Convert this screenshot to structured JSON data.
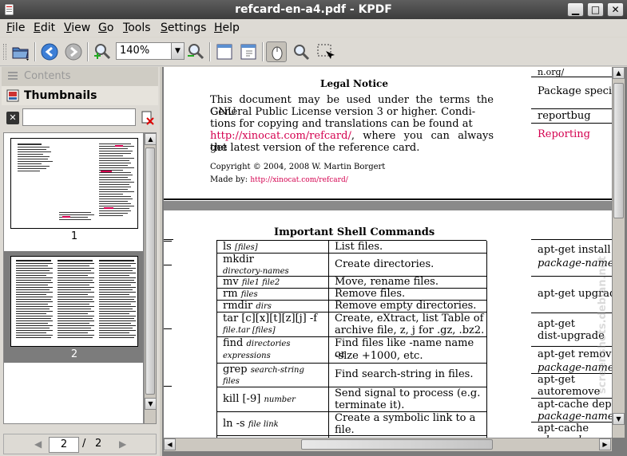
{
  "window": {
    "title": "refcard-en-a4.pdf - KPDF",
    "min_glyph": "▁",
    "max_glyph": "□",
    "close_glyph": "✕"
  },
  "menubar": {
    "items": [
      {
        "pre": "",
        "u": "F",
        "post": "ile"
      },
      {
        "pre": "",
        "u": "E",
        "post": "dit"
      },
      {
        "pre": "",
        "u": "V",
        "post": "iew"
      },
      {
        "pre": "",
        "u": "G",
        "post": "o"
      },
      {
        "pre": "",
        "u": "T",
        "post": "ools"
      },
      {
        "pre": "",
        "u": "S",
        "post": "ettings"
      },
      {
        "pre": "",
        "u": "H",
        "post": "elp"
      }
    ]
  },
  "toolbar": {
    "zoom_value": "140%",
    "zoom_arrow": "▼",
    "icons": [
      "open-folder-icon",
      "back-icon",
      "forward-icon",
      "zoom-in-icon",
      "zoom-out-icon",
      "fit-width-icon",
      "fit-page-icon",
      "browse-tool-icon",
      "zoom-tool-icon",
      "select-tool-icon"
    ]
  },
  "sidebar": {
    "contents_label": "Contents",
    "thumbnails_label": "Thumbnails",
    "search_value": "",
    "thumbs": [
      {
        "label": "1"
      },
      {
        "label": "2"
      }
    ],
    "pager": {
      "current": "2",
      "separator": "/",
      "total": "2"
    }
  },
  "document": {
    "legal_title": "Legal Notice",
    "legal_lines": [
      "This document may be used under the terms the GNU",
      "General Public License version 3 or higher.  Condi-",
      "tions for copying and translations can be found at"
    ],
    "legal_link": "http://xinocat.com/refcard/",
    "legal_after_link": ", where you can always get",
    "legal_last": "the latest version of the reference card.",
    "copyright": "Copyright © 2004, 2008 W. Martin Borgert",
    "madeby_label": "Made by:",
    "madeby_link": "http://xinocat.com/refcard/",
    "shell_title": "Important Shell Commands",
    "rows": [
      {
        "cmd": "ls",
        "arg": "[files]",
        "desc": "List files."
      },
      {
        "cmd": "mkdir",
        "arg": "directory-names",
        "desc": "Create directories."
      },
      {
        "cmd": "mv",
        "arg": "file1   file2",
        "desc": "Move, rename files."
      },
      {
        "cmd": "rm",
        "arg": "files",
        "desc": "Remove files."
      },
      {
        "cmd": "rmdir",
        "arg": "dirs",
        "desc": "Remove empty directories."
      },
      {
        "cmd": "tar [c][x][t][z][j] -f",
        "arg": "file.tar   [files]",
        "desc": "Create, eXtract, list Table of",
        "desc2": "archive file, z, j for .gz, .bz2."
      },
      {
        "cmd": "find",
        "arg": "directories",
        "arg2": "expressions",
        "desc": "Find files like -name name or",
        "desc2": "-size +1000, etc."
      },
      {
        "cmd": "grep",
        "arg": "search-string",
        "arg2": "files",
        "desc": "Find search-string in files."
      },
      {
        "cmd": "kill [-9]",
        "arg": "number",
        "desc": "Send signal to process (e.g.",
        "desc2": "terminate it)."
      },
      {
        "cmd": "ln -s",
        "arg": "file link",
        "desc": "Create a symbolic link to a",
        "desc2": "file."
      }
    ],
    "right_top": [
      {
        "text": "n.org/"
      },
      {
        "text": "Package specif"
      },
      {
        "text": "reportbug"
      },
      {
        "text": "Reporting"
      }
    ],
    "right_cmds": [
      {
        "cmd": "apt-get install",
        "arg": "package-names"
      },
      {
        "cmd": "apt-get upgrad",
        "arg": ""
      },
      {
        "cmd": "apt-get",
        "arg": "dist-upgrade"
      },
      {
        "cmd": "apt-get remove",
        "arg": "package-names"
      },
      {
        "cmd": "apt-get",
        "arg": "autoremove"
      },
      {
        "cmd": "apt-cache depe",
        "arg": "package-names"
      },
      {
        "cmd": "apt-cache",
        "arg": "rdepends"
      }
    ],
    "watermark": "screenshots.debian.net"
  }
}
